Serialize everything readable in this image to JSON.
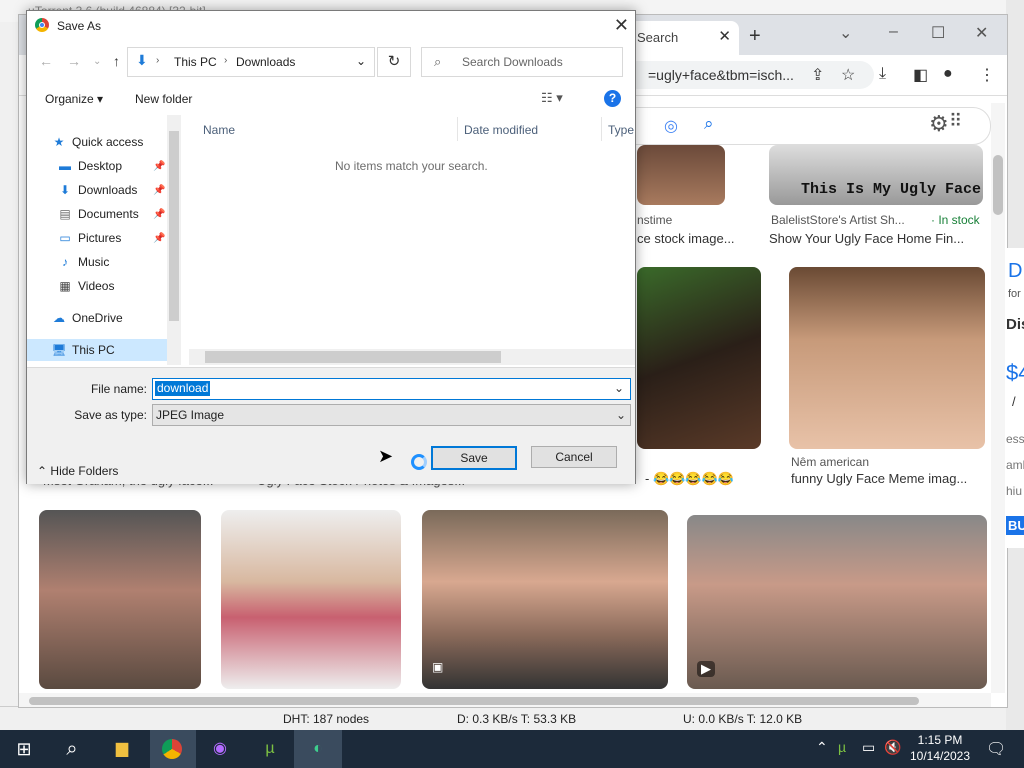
{
  "utorrent": {
    "title": "µTorrent 3.6 (build 46884) [32-bit]",
    "status": {
      "dht": "DHT: 187 nodes",
      "download": "D: 0.3 KB/s T: 53.3 KB",
      "upload": "U: 0.0 KB/s T: 12.0 KB"
    }
  },
  "chrome": {
    "tab_label": "Search",
    "address": "=ugly+face&tbm=isch...",
    "results": [
      {
        "source": "nstime",
        "caption": "ce stock image..."
      },
      {
        "source": "BalelistStore's Artist Sh...",
        "badge": "· In stock",
        "caption": "Show Your Ugly Face Home Fin...",
        "overlay_text": "This Is My Ugly Face"
      },
      {
        "caption": "- 😂😂😂😂😂"
      },
      {
        "source": "Nêm american",
        "caption": "funny Ugly Face Meme imag..."
      }
    ],
    "row2_captions": [
      "Mset Graham, the ugly face...",
      "Ugly Face Stock Photos & Images..."
    ],
    "ad_edge_text": [
      "D",
      "for",
      "Dis",
      "$4",
      "/",
      "ess",
      "amb",
      "hiu",
      "BUY"
    ]
  },
  "dialog": {
    "title": "Save As",
    "breadcrumb": [
      "This PC",
      "Downloads"
    ],
    "search_placeholder": "Search Downloads",
    "organize_label": "Organize ▾",
    "new_folder_label": "New folder",
    "nav": {
      "quick_access": "Quick access",
      "desktop": "Desktop",
      "downloads": "Downloads",
      "documents": "Documents",
      "pictures": "Pictures",
      "music": "Music",
      "videos": "Videos",
      "onedrive": "OneDrive",
      "this_pc": "This PC"
    },
    "columns": {
      "name": "Name",
      "date_modified": "Date modified",
      "type": "Type"
    },
    "empty_message": "No items match your search.",
    "file_name_label": "File name:",
    "file_name_value": "download",
    "save_type_label": "Save as type:",
    "save_type_value": "JPEG Image",
    "hide_folders": "Hide Folders",
    "save_label": "Save",
    "cancel_label": "Cancel"
  },
  "taskbar": {
    "time": "1:15 PM",
    "date": "10/14/2023"
  }
}
